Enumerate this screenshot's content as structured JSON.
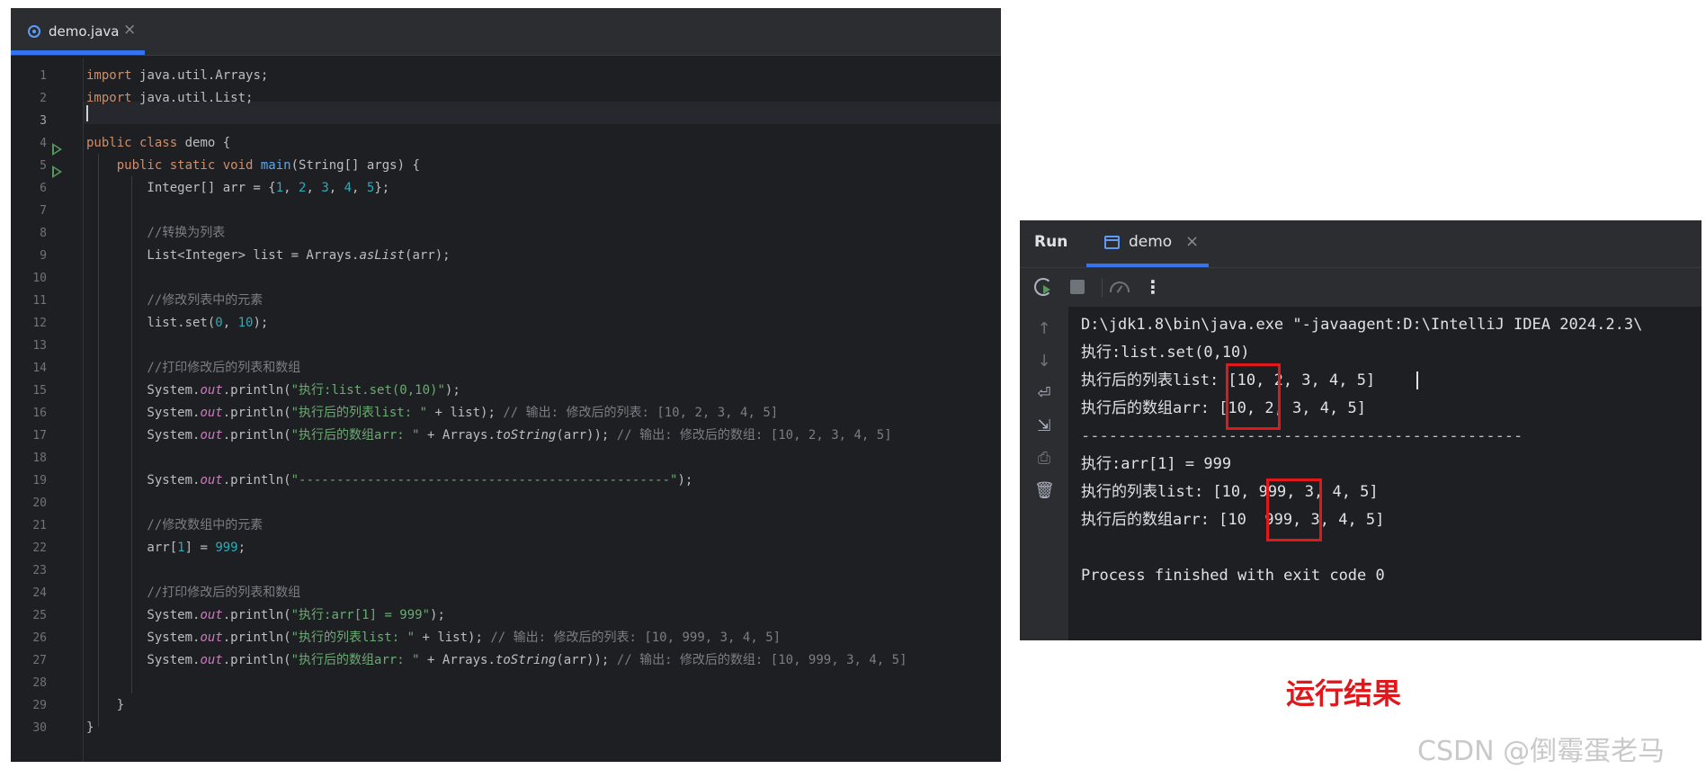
{
  "editor": {
    "tab": {
      "file_name": "demo.java",
      "close": "×"
    },
    "line_numbers": [
      "1",
      "2",
      "3",
      "4",
      "5",
      "6",
      "7",
      "8",
      "9",
      "10",
      "11",
      "12",
      "13",
      "14",
      "15",
      "16",
      "17",
      "18",
      "19",
      "20",
      "21",
      "22",
      "23",
      "24",
      "25",
      "26",
      "27",
      "28",
      "29",
      "30"
    ],
    "current_line": 3,
    "run_gutter_lines": [
      4,
      5
    ],
    "code": [
      "import java.util.Arrays;",
      "import java.util.List;",
      "",
      "public class demo {",
      "    public static void main(String[] args) {",
      "        Integer[] arr = {1, 2, 3, 4, 5};",
      "",
      "        //转换为列表",
      "        List<Integer> list = Arrays.asList(arr);",
      "",
      "        //修改列表中的元素",
      "        list.set(0, 10);",
      "",
      "        //打印修改后的列表和数组",
      "        System.out.println(\"执行:list.set(0,10)\");",
      "        System.out.println(\"执行后的列表list: \" + list); // 输出: 修改后的列表: [10, 2, 3, 4, 5]",
      "        System.out.println(\"执行后的数组arr: \" + Arrays.toString(arr)); // 输出: 修改后的数组: [10, 2, 3, 4, 5]",
      "",
      "        System.out.println(\"-------------------------------------------------\");",
      "",
      "        //修改数组中的元素",
      "        arr[1] = 999;",
      "",
      "        //打印修改后的列表和数组",
      "        System.out.println(\"执行:arr[1] = 999\");",
      "        System.out.println(\"执行的列表list: \" + list); // 输出: 修改后的列表: [10, 999, 3, 4, 5]",
      "        System.out.println(\"执行后的数组arr: \" + Arrays.toString(arr)); // 输出: 修改后的数组: [10, 999, 3, 4, 5]",
      "",
      "    }",
      "}"
    ]
  },
  "run_panel": {
    "title": "Run",
    "tab_label": "demo",
    "tab_close": "×",
    "toolbar": {
      "rerun": "rerun-icon",
      "stop": "stop-icon",
      "profiler": "gauge-icon",
      "more": "⋮"
    },
    "side_icons": [
      "↑",
      "↓",
      "⏎",
      "⇲",
      "⎙",
      "🗑"
    ],
    "output": [
      "D:\\jdk1.8\\bin\\java.exe \"-javaagent:D:\\IntelliJ IDEA 2024.2.3\\",
      "执行:list.set(0,10)",
      "执行后的列表list: [10, 2, 3, 4, 5]",
      "执行后的数组arr: [10, 2, 3, 4, 5]",
      "------------------------------------------------",
      "执行:arr[1] = 999",
      "执行的列表list: [10, 999, 3, 4, 5]",
      "执行后的数组arr: [10  999, 3, 4, 5]",
      "",
      "Process finished with exit code 0"
    ]
  },
  "captions": {
    "result": "运行结果",
    "watermark": "CSDN @倒霉蛋老马"
  },
  "colors": {
    "editor_bg": "#1e1f22",
    "panel_bg": "#2b2d30",
    "accent": "#3574f0",
    "keyword": "#cf8e6d",
    "number": "#2aacb8",
    "string": "#6aab73",
    "comment": "#7a7e85",
    "highlight_box": "#e0171b"
  }
}
